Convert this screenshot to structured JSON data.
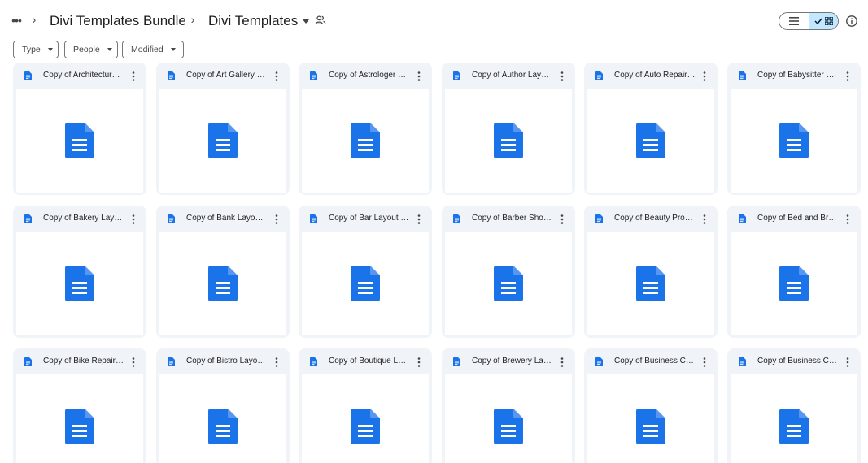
{
  "breadcrumb": {
    "items": [
      {
        "label": "Divi Templates Bundle"
      },
      {
        "label": "Divi Templates"
      }
    ]
  },
  "filters": [
    {
      "label": "Type"
    },
    {
      "label": "People"
    },
    {
      "label": "Modified"
    }
  ],
  "files": [
    {
      "name": "Copy of Architecture Layout Pack"
    },
    {
      "name": "Copy of Art Gallery Layout Pack"
    },
    {
      "name": "Copy of Astrologer Layout Pack"
    },
    {
      "name": "Copy of Author Layout Pack"
    },
    {
      "name": "Copy of Auto Repair Layout Pack"
    },
    {
      "name": "Copy of Babysitter Layout Pack"
    },
    {
      "name": "Copy of Bakery Layout Pack"
    },
    {
      "name": "Copy of Bank Layout Pack"
    },
    {
      "name": "Copy of Bar Layout Pack"
    },
    {
      "name": "Copy of Barber Shop Layout Pack"
    },
    {
      "name": "Copy of Beauty Product Layout Pack"
    },
    {
      "name": "Copy of Bed and Breakfast Layout Pack"
    },
    {
      "name": "Copy of Bike Repair Layout Pack"
    },
    {
      "name": "Copy of Bistro Layout Pack"
    },
    {
      "name": "Copy of Boutique Layout Pack"
    },
    {
      "name": "Copy of Brewery Layout Pack"
    },
    {
      "name": "Copy of Business Coach Layout Pack"
    },
    {
      "name": "Copy of Business Consultant Layout Pack"
    }
  ],
  "colors": {
    "doc_blue": "#1a73e8",
    "card_bg": "#f0f4f9",
    "toggle_active": "#c2e7ff"
  },
  "icons": {
    "more": "more-horiz-icon",
    "separator": "chevron-right-icon",
    "shared": "shared-people-icon",
    "list_view": "list-view-icon",
    "grid_view": "grid-view-icon",
    "check": "check-icon",
    "info": "info-icon",
    "doc": "google-docs-icon",
    "kebab": "more-vert-icon"
  }
}
